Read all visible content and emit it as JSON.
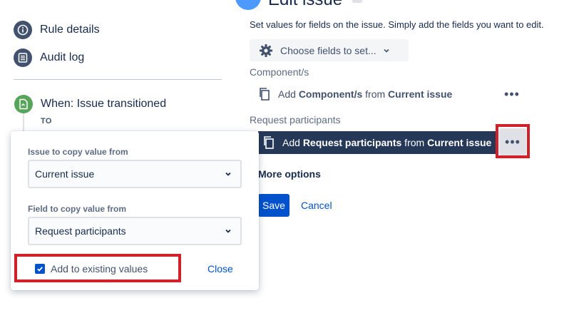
{
  "sidebar": {
    "items": [
      {
        "label": "Rule details",
        "icon": "info-icon"
      },
      {
        "label": "Audit log",
        "icon": "list-icon"
      }
    ],
    "trigger": {
      "label": "When: Issue transitioned",
      "sublabel": "TO",
      "icon": "issue-trigger-icon"
    }
  },
  "popup": {
    "issue_field_label": "Issue to copy value from",
    "issue_field_value": "Current issue",
    "field_label": "Field to copy value from",
    "field_value": "Request participants",
    "checkbox_label": "Add to existing values",
    "checkbox_checked": true,
    "close_label": "Close"
  },
  "edit_issue": {
    "title": "Edit issue",
    "description": "Set values for fields on the issue. Simply add the fields you want to edit.",
    "choose_fields_label": "Choose fields to set...",
    "sections": [
      {
        "label": "Component/s",
        "row": {
          "prefix": "Add ",
          "field": "Component/s",
          "middle": " from ",
          "source": "Current issue"
        },
        "menu_label": "•••"
      },
      {
        "label": "Request participants",
        "row": {
          "prefix": "Add ",
          "field": "Request participants",
          "middle": " from ",
          "source": "Current issue"
        },
        "menu_label": "•••"
      }
    ],
    "more_options_label": "More options",
    "save_label": "Save",
    "cancel_label": "Cancel"
  },
  "colors": {
    "primary": "#0052cc",
    "dark_row": "#253858",
    "highlight": "#d0202a",
    "trigger_green": "#57a55a",
    "nav_icon": "#42526e"
  }
}
